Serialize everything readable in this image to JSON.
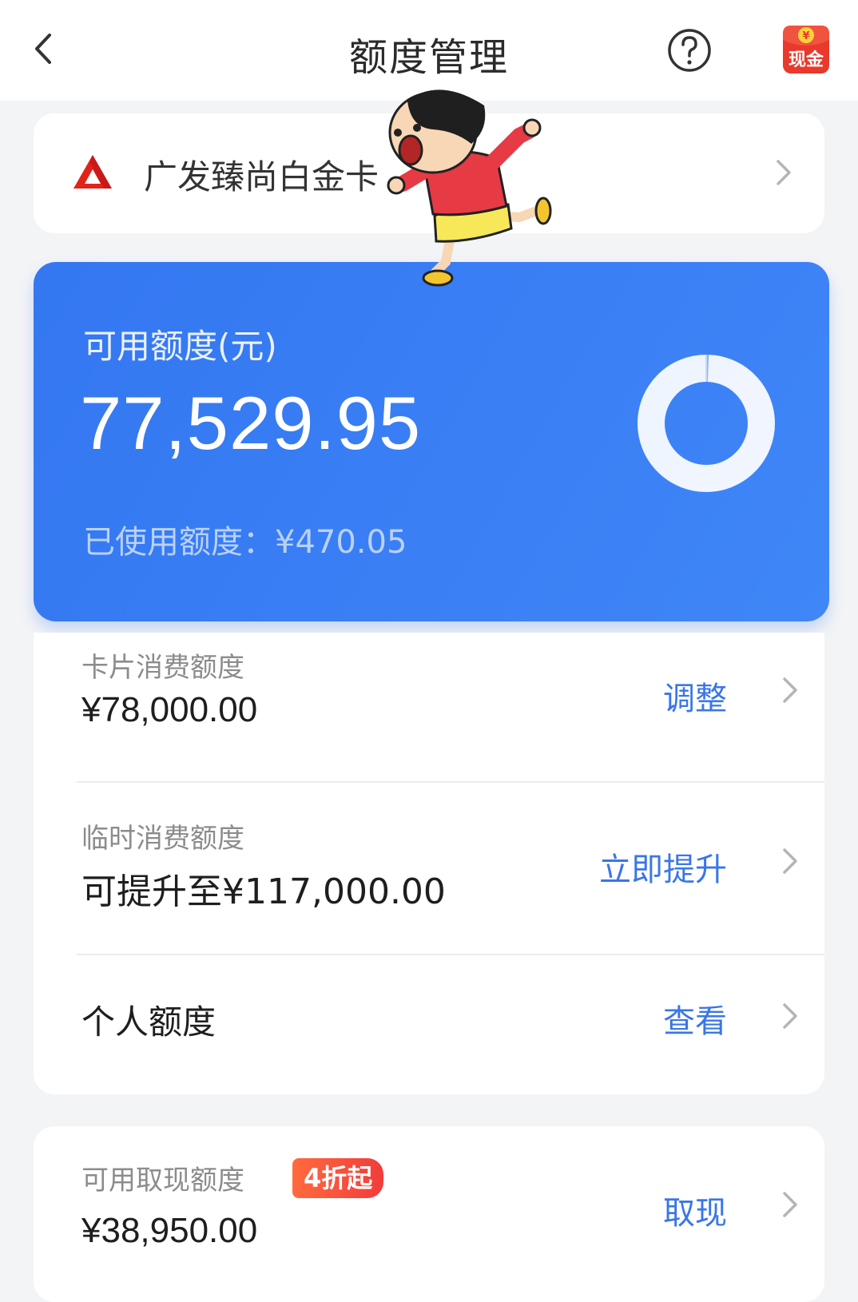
{
  "header": {
    "title": "额度管理",
    "back_icon": "chevron-left-icon",
    "help_icon": "question-circle-icon",
    "cash_badge_icon": "cash-red-envelope-icon",
    "cash_badge_label": "现金"
  },
  "card": {
    "name": "广发臻尚白金卡",
    "logo_icon": "bank-logo-icon"
  },
  "available": {
    "label": "可用额度(元)",
    "value": "77,529.95",
    "used_text": "已使用额度：¥470.05",
    "used_fraction": 0.006
  },
  "limits": [
    {
      "label": "卡片消费额度",
      "value": "¥78,000.00",
      "action": "调整"
    },
    {
      "label": "临时消费额度",
      "value": "可提升至¥117,000.00",
      "action": "立即提升"
    },
    {
      "label": "",
      "value": "个人额度",
      "action": "查看"
    }
  ],
  "cash": {
    "label": "可用取现额度",
    "badge": "4折起",
    "value": "¥38,950.00",
    "action": "取现"
  },
  "colors": {
    "primary_blue": "#3a7ef3",
    "action_blue": "#3a76e8",
    "badge_red": "#f23c3c",
    "page_bg": "#f3f4f6"
  }
}
